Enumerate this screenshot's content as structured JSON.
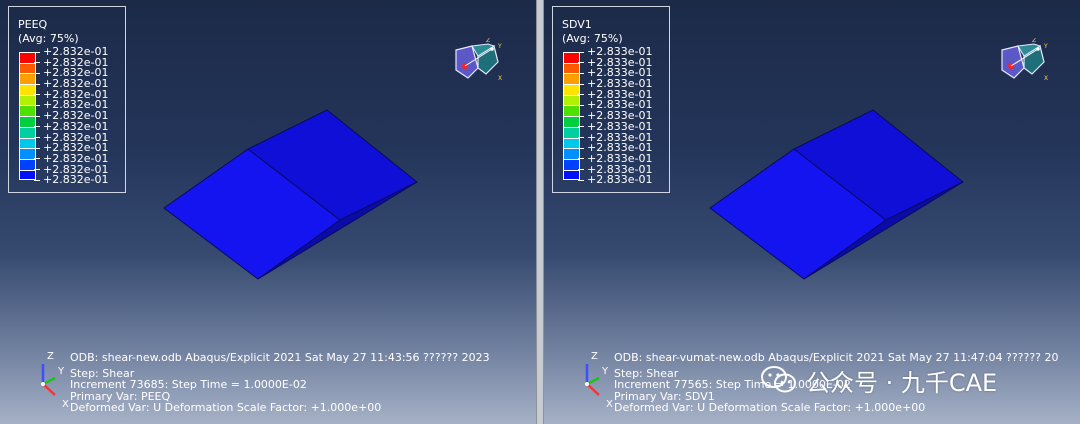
{
  "left": {
    "legend": {
      "variable": "PEEQ",
      "averaging": "(Avg: 75%)",
      "values": [
        "+2.832e-01",
        "+2.832e-01",
        "+2.832e-01",
        "+2.832e-01",
        "+2.832e-01",
        "+2.832e-01",
        "+2.832e-01",
        "+2.832e-01",
        "+2.832e-01",
        "+2.832e-01",
        "+2.832e-01",
        "+2.832e-01",
        "+2.832e-01"
      ]
    },
    "info": {
      "line1": "ODB: shear-new.odb    Abaqus/Explicit 2021    Sat May 27 11:43:56 ?????? 2023",
      "line2": "Step: Shear",
      "line3": "Increment     73685: Step Time =    1.0000E-02",
      "line4": "Primary Var: PEEQ",
      "line5": "Deformed Var: U   Deformation Scale Factor: +1.000e+00"
    }
  },
  "right": {
    "legend": {
      "variable": "SDV1",
      "averaging": "(Avg: 75%)",
      "values": [
        "+2.833e-01",
        "+2.833e-01",
        "+2.833e-01",
        "+2.833e-01",
        "+2.833e-01",
        "+2.833e-01",
        "+2.833e-01",
        "+2.833e-01",
        "+2.833e-01",
        "+2.833e-01",
        "+2.833e-01",
        "+2.833e-01",
        "+2.833e-01"
      ]
    },
    "info": {
      "line1": "ODB: shear-vumat-new.odb    Abaqus/Explicit 2021    Sat May 27 11:47:04 ?????? 20",
      "line2": "Step: Shear",
      "line3": "Increment     77565: Step Time =    1.0000E-02",
      "line4": "Primary Var: SDV1",
      "line5": "Deformed Var: U   Deformation Scale Factor: +1.000e+00"
    }
  },
  "axis_labels": {
    "z": "Z",
    "y": "Y",
    "x": "X"
  },
  "watermark": "公众号 · 九千CAE",
  "colors": {
    "contour": [
      "#ff0000",
      "#ff4a00",
      "#ff9800",
      "#ffe000",
      "#c8ff00",
      "#6cff00",
      "#00e000",
      "#00d070",
      "#00d8d8",
      "#00a8ff",
      "#0060ff",
      "#0020ff",
      "#0000ff"
    ],
    "model_face_top": "#1414f0",
    "model_face_side": "#0a0ab8",
    "model_face_dark": "#12129a"
  }
}
